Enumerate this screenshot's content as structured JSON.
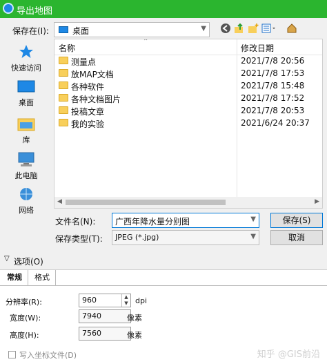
{
  "window": {
    "title": "导出地图"
  },
  "lookin": {
    "label": "保存在(I):",
    "value": "桌面"
  },
  "toolbar": {
    "back_icon": "back-arrow-icon",
    "up_icon": "up-folder-icon",
    "newfolder_icon": "new-folder-icon",
    "view_icon": "view-menu-icon",
    "desktop_icon": "desktop-icon"
  },
  "sidebar": {
    "items": [
      {
        "label": "快速访问",
        "icon": "star-icon"
      },
      {
        "label": "桌面",
        "icon": "desktop-icon"
      },
      {
        "label": "库",
        "icon": "library-icon"
      },
      {
        "label": "此电脑",
        "icon": "computer-icon"
      },
      {
        "label": "网络",
        "icon": "network-icon"
      }
    ]
  },
  "filelist": {
    "col_name": "名称",
    "col_date": "修改日期",
    "rows": [
      {
        "name": "测量点",
        "date": "2021/7/8 20:56"
      },
      {
        "name": "放MAP文档",
        "date": "2021/7/8 17:53"
      },
      {
        "name": "各种软件",
        "date": "2021/7/8 15:48"
      },
      {
        "name": "各种文档图片",
        "date": "2021/7/8 17:52"
      },
      {
        "name": "投稿文章",
        "date": "2021/7/8 20:53"
      },
      {
        "name": "我的实验",
        "date": "2021/6/24 20:37"
      }
    ]
  },
  "filename": {
    "label": "文件名(N):",
    "value": "广西年降水量分别图"
  },
  "filetype": {
    "label": "保存类型(T):",
    "value": "JPEG (*.jpg)"
  },
  "buttons": {
    "save": "保存(S)",
    "cancel": "取消"
  },
  "options": {
    "label": "选项(O)"
  },
  "tabs": [
    {
      "label": "常规"
    },
    {
      "label": "格式"
    }
  ],
  "settings": {
    "resolution": {
      "label": "分辨率(R):",
      "value": "960",
      "unit": "dpi"
    },
    "width": {
      "label": "宽度(W):",
      "value": "7940",
      "unit": "像素"
    },
    "height": {
      "label": "高度(H):",
      "value": "7560",
      "unit": "像素"
    },
    "worldfile": {
      "label": "写入坐标文件(D)",
      "checked": false
    }
  },
  "watermark": "知乎 @GIS前沿"
}
